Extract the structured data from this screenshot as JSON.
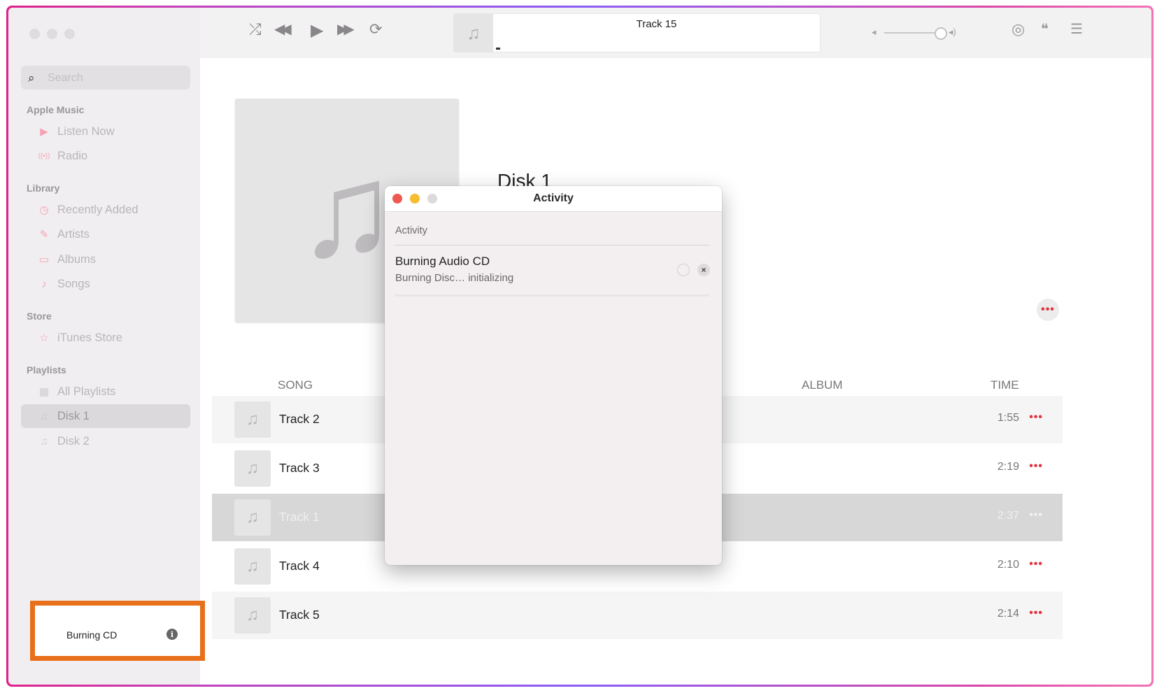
{
  "toolbar": {
    "shuffle_icon": "⤮",
    "prev_icon": "◀◀",
    "play_icon": "▶",
    "next_icon": "▶▶",
    "repeat_icon": "⟳",
    "now_playing_title": "Track 15",
    "artwork_icon": "♫",
    "airplay_icon": "◎",
    "lyrics_icon": "❝",
    "queue_icon": "☰"
  },
  "sidebar": {
    "search_placeholder": "Search",
    "sections": [
      {
        "title": "Apple Music",
        "items": [
          {
            "label": "Listen Now",
            "icon": "▶"
          },
          {
            "label": "Radio",
            "icon": "((•))"
          }
        ]
      },
      {
        "title": "Library",
        "items": [
          {
            "label": "Recently Added",
            "icon": "◷"
          },
          {
            "label": "Artists",
            "icon": "✎"
          },
          {
            "label": "Albums",
            "icon": "▭"
          },
          {
            "label": "Songs",
            "icon": "♪"
          }
        ]
      },
      {
        "title": "Store",
        "items": [
          {
            "label": "iTunes Store",
            "icon": "☆"
          }
        ]
      },
      {
        "title": "Playlists",
        "items": [
          {
            "label": "All Playlists",
            "icon": "▦"
          },
          {
            "label": "Disk 1",
            "icon": "♫",
            "selected": true
          },
          {
            "label": "Disk 2",
            "icon": "♫"
          }
        ]
      }
    ]
  },
  "main": {
    "album_title": "Disk 1",
    "more_label": "•••",
    "columns": {
      "song": "SONG",
      "album": "ALBUM",
      "time": "TIME"
    },
    "tracks": [
      {
        "name": "Track 2",
        "time": "1:55"
      },
      {
        "name": "Track 3",
        "time": "2:19"
      },
      {
        "name": "Track 1",
        "time": "2:37",
        "selected": true
      },
      {
        "name": "Track 4",
        "time": "2:10"
      },
      {
        "name": "Track 5",
        "time": "2:14"
      }
    ],
    "row_more": "•••"
  },
  "dialog": {
    "title": "Activity",
    "section_header": "Activity",
    "job_title": "Burning Audio CD",
    "job_status": "Burning Disc… initializing",
    "stop_icon": "×"
  },
  "status": {
    "label": "Burning CD",
    "info_icon": "i"
  }
}
